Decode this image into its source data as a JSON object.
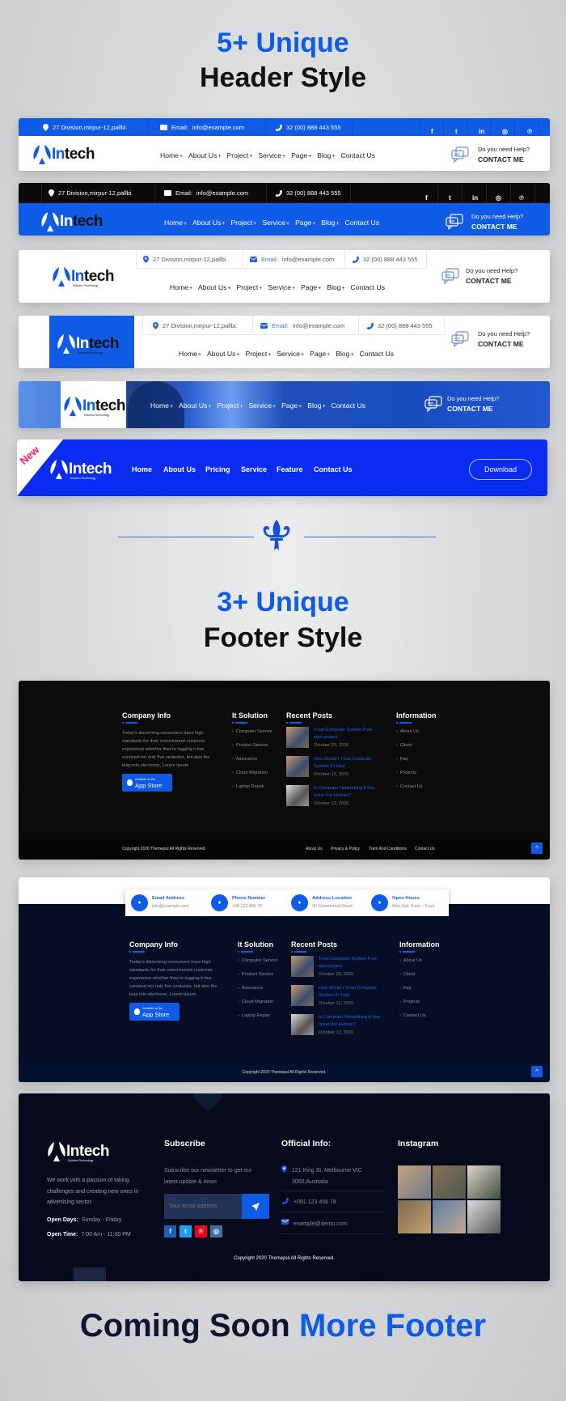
{
  "headline1": {
    "accent": "5+ Unique",
    "main": "Header Style"
  },
  "headline2": {
    "accent": "3+ Unique",
    "main": "Footer Style"
  },
  "closing": {
    "main": "Coming Soon",
    "accent": "More Footer"
  },
  "logo": {
    "name": "Intech",
    "first": "In",
    "rest": "tech",
    "tagline": "Solution Technology"
  },
  "colors": {
    "accent": "#0f5be6",
    "dark": "#0a0a0a",
    "navy": "#050d24",
    "header6": "#0a2cf0",
    "new_badge": "#ff1d5e"
  },
  "header": {
    "info": {
      "address": "27 Division,mirpur-12,pallbi.",
      "email_label": "Email:",
      "email": "info@example.com",
      "phone": "32 (00) 888 443 555"
    },
    "social_icons": [
      "facebook-icon",
      "twitter-icon",
      "linkedin-icon",
      "instagram-icon",
      "pinterest-icon"
    ],
    "nav": [
      "Home",
      "About Us",
      "Project",
      "Service",
      "Page",
      "Blog",
      "Contact Us"
    ],
    "nav_suffix": "+",
    "help": "Do you need Help?",
    "contact": "CONTACT ME"
  },
  "header6": {
    "badge": "New",
    "nav": [
      "Home",
      "About Us",
      "Pricing",
      "Service",
      "Feature",
      "Contact Us"
    ],
    "download": "Download"
  },
  "footer": {
    "company_heading": "Company Info",
    "company_text": "Today's discerning consumers have high standards for their omnichannel customer experience whether they're logging it has survived not only five centuries, but also the leap into electronic, Lorem Ipsum",
    "app_small": "Available on the",
    "app_big": "App Store",
    "solution_heading": "It Solution",
    "solutions": [
      "Computer Service",
      "Product Service",
      "Assurance",
      "Cloud Migration",
      "Laptop Repair"
    ],
    "posts_heading": "Recent Posts",
    "posts": [
      {
        "title": "Treat Computer System If we start project",
        "date": "October 20, 2020"
      },
      {
        "title": "How Would I Treat Computer System If I Had",
        "date": "October 12, 2020"
      },
      {
        "title": "Is Computer Networking A Key Issue For Human?",
        "date": "October 12, 2020"
      }
    ],
    "info_heading": "Information",
    "info_links": [
      "About Us",
      "Client",
      "Faq",
      "Projects",
      "Contact Us"
    ],
    "copyright": "Copyright 2020 Themepul All Rights Reserved.",
    "bottom_links": [
      "About Us",
      "Privacy & Policy",
      "Tram And Conditions",
      "Contact Us"
    ],
    "scroll_top": "^"
  },
  "footer2": {
    "contacts": [
      {
        "label": "Email Address",
        "value": "info@example.com",
        "icon": "home-icon"
      },
      {
        "label": "Phone Number",
        "value": "+99 123 456 78",
        "icon": "phone-icon"
      },
      {
        "label": "Address Location",
        "value": "30 Commercial Road",
        "icon": "location-icon"
      },
      {
        "label": "Open Hours:",
        "value": "Mon-Sat: 8 am – 5 pm",
        "icon": "clock-icon"
      }
    ]
  },
  "footer3": {
    "about": "We work with a passion of taking challenges and creating new ones in advertising sector.",
    "open_days_label": "Open Days:",
    "open_days": "Sunday - Friday",
    "open_time_label": "Open Time:",
    "open_time": "7:00 Am - 11:00 PM",
    "subscribe_heading": "Subscribe",
    "subscribe_text": "Subscribe our newsletter to get our latest update & news",
    "email_placeholder": "Your email address",
    "social_icons": [
      "facebook-icon",
      "twitter-icon",
      "pinterest-icon",
      "instagram-icon"
    ],
    "social_colors": [
      "#1b5fb8",
      "#1ea1f2",
      "#e60023",
      "#3f729b"
    ],
    "official_heading": "Official Info:",
    "address": "121 King St, Melbourne VIC 3000,Australia",
    "phone": "+091 123 456 78",
    "email": "example@demo.com",
    "instagram_heading": "Instagram",
    "copyright": "Copyright 2020 Themepul All Rights Reserved."
  }
}
